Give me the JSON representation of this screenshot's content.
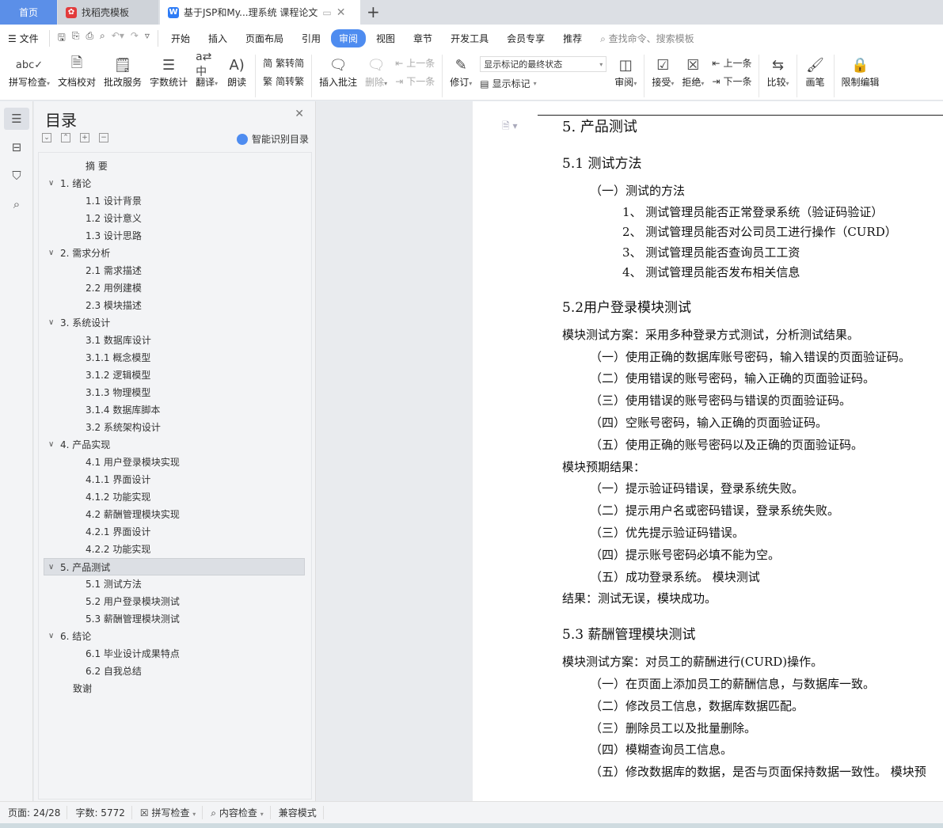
{
  "tabs": {
    "home": "首页",
    "template": "找稻壳模板",
    "doc": "基于JSP和My...理系统 课程论文"
  },
  "menu": {
    "file": "文件",
    "items": [
      "开始",
      "插入",
      "页面布局",
      "引用",
      "审阅",
      "视图",
      "章节",
      "开发工具",
      "会员专享",
      "推荐"
    ],
    "active_index": 4,
    "search_placeholder": "查找命令、搜索模板"
  },
  "ribbon": {
    "spell": "拼写检查",
    "proof": "文档校对",
    "correct": "批改服务",
    "wordcount": "字数统计",
    "translate": "翻译",
    "read": "朗读",
    "trad2simp": "繁转简",
    "simp2trad": "简转繁",
    "insert_comment": "插入批注",
    "delete": "删除",
    "prev": "上一条",
    "next": "下一条",
    "revise": "修订",
    "markup_state": "显示标记的最终状态",
    "show_markup": "显示标记",
    "review": "审阅",
    "accept": "接受",
    "reject": "拒绝",
    "prev2": "上一条",
    "next2": "下一条",
    "compare": "比较",
    "pen": "画笔",
    "restrict": "限制编辑"
  },
  "toc": {
    "title": "目录",
    "smart": "智能识别目录",
    "items": [
      {
        "t": "摘 要",
        "lv": "l0"
      },
      {
        "t": "1. 绪论",
        "lv": "l1"
      },
      {
        "t": "1.1 设计背景",
        "lv": "l2"
      },
      {
        "t": "1.2 设计意义",
        "lv": "l2"
      },
      {
        "t": "1.3 设计思路",
        "lv": "l2"
      },
      {
        "t": "2. 需求分析",
        "lv": "l1"
      },
      {
        "t": "2.1 需求描述",
        "lv": "l2"
      },
      {
        "t": "2.2 用例建模",
        "lv": "l2"
      },
      {
        "t": "2.3 模块描述",
        "lv": "l2"
      },
      {
        "t": "3. 系统设计",
        "lv": "l1"
      },
      {
        "t": "3.1 数据库设计",
        "lv": "l2"
      },
      {
        "t": "3.1.1 概念模型",
        "lv": "l2"
      },
      {
        "t": "3.1.2 逻辑模型",
        "lv": "l2"
      },
      {
        "t": "3.1.3 物理模型",
        "lv": "l2"
      },
      {
        "t": "3.1.4 数据库脚本",
        "lv": "l2"
      },
      {
        "t": "3.2 系统架构设计",
        "lv": "l2"
      },
      {
        "t": "4. 产品实现",
        "lv": "l1"
      },
      {
        "t": "4.1 用户登录模块实现",
        "lv": "l2"
      },
      {
        "t": "4.1.1 界面设计",
        "lv": "l2"
      },
      {
        "t": "4.1.2 功能实现",
        "lv": "l2"
      },
      {
        "t": "4.2 薪酬管理模块实现",
        "lv": "l2"
      },
      {
        "t": "4.2.1 界面设计",
        "lv": "l2"
      },
      {
        "t": "4.2.2 功能实现",
        "lv": "l2"
      },
      {
        "t": "5. 产品测试",
        "lv": "l1",
        "sel": true
      },
      {
        "t": "5.1 测试方法",
        "lv": "l2"
      },
      {
        "t": "5.2 用户登录模块测试",
        "lv": "l2"
      },
      {
        "t": "5.3 薪酬管理模块测试",
        "lv": "l2"
      },
      {
        "t": "6. 结论",
        "lv": "l1"
      },
      {
        "t": "6.1 毕业设计成果特点",
        "lv": "l2"
      },
      {
        "t": "6.2 自我总结",
        "lv": "l2"
      },
      {
        "t": "致谢",
        "lv": "l0b"
      }
    ]
  },
  "doc": [
    {
      "t": "5. 产品测试",
      "c": "h1"
    },
    {
      "t": "5.1 测试方法",
      "c": "h2"
    },
    {
      "t": "（一）测试的方法",
      "c": "p in1"
    },
    {
      "t": "1、  测试管理员能否正常登录系统（验证码验证）",
      "c": "num"
    },
    {
      "t": "2、  测试管理员能否对公司员工进行操作（CURD）",
      "c": "num"
    },
    {
      "t": "3、  测试管理员能否查询员工工资",
      "c": "num"
    },
    {
      "t": "4、  测试管理员能否发布相关信息",
      "c": "num"
    },
    {
      "t": "5.2用户登录模块测试",
      "c": "h2"
    },
    {
      "t": "模块测试方案：采用多种登录方式测试，分析测试结果。",
      "c": "p"
    },
    {
      "t": "（一）使用正确的数据库账号密码，输入错误的页面验证码。",
      "c": "p in1"
    },
    {
      "t": "（二）使用错误的账号密码，输入正确的页面验证码。",
      "c": "p in1"
    },
    {
      "t": "（三）使用错误的账号密码与错误的页面验证码。",
      "c": "p in1"
    },
    {
      "t": "（四）空账号密码，输入正确的页面验证码。",
      "c": "p in1"
    },
    {
      "t": "（五）使用正确的账号密码以及正确的页面验证码。",
      "c": "p in1"
    },
    {
      "t": "模块预期结果：",
      "c": "p"
    },
    {
      "t": "（一）提示验证码错误，登录系统失败。",
      "c": "p in1"
    },
    {
      "t": "（二）提示用户名或密码错误，登录系统失败。",
      "c": "p in1"
    },
    {
      "t": "（三）优先提示验证码错误。",
      "c": "p in1"
    },
    {
      "t": "（四）提示账号密码必填不能为空。",
      "c": "p in1"
    },
    {
      "t": "（五）成功登录系统。 模块测试",
      "c": "p in1"
    },
    {
      "t": "结果：测试无误，模块成功。",
      "c": "p"
    },
    {
      "t": "5.3 薪酬管理模块测试",
      "c": "h2"
    },
    {
      "t": "模块测试方案：对员工的薪酬进行(CURD)操作。",
      "c": "p"
    },
    {
      "t": "（一）在页面上添加员工的薪酬信息，与数据库一致。",
      "c": "p in1"
    },
    {
      "t": "（二）修改员工信息，数据库数据匹配。",
      "c": "p in1"
    },
    {
      "t": "（三）删除员工以及批量删除。",
      "c": "p in1"
    },
    {
      "t": "（四）模糊查询员工信息。",
      "c": "p in1"
    },
    {
      "t": "（五）修改数据库的数据，是否与页面保持数据一致性。 模块预",
      "c": "p in1"
    }
  ],
  "status": {
    "page": "页面: 24/28",
    "words": "字数: 5772",
    "spell": "拼写检查",
    "content": "内容检查",
    "compat": "兼容模式"
  }
}
